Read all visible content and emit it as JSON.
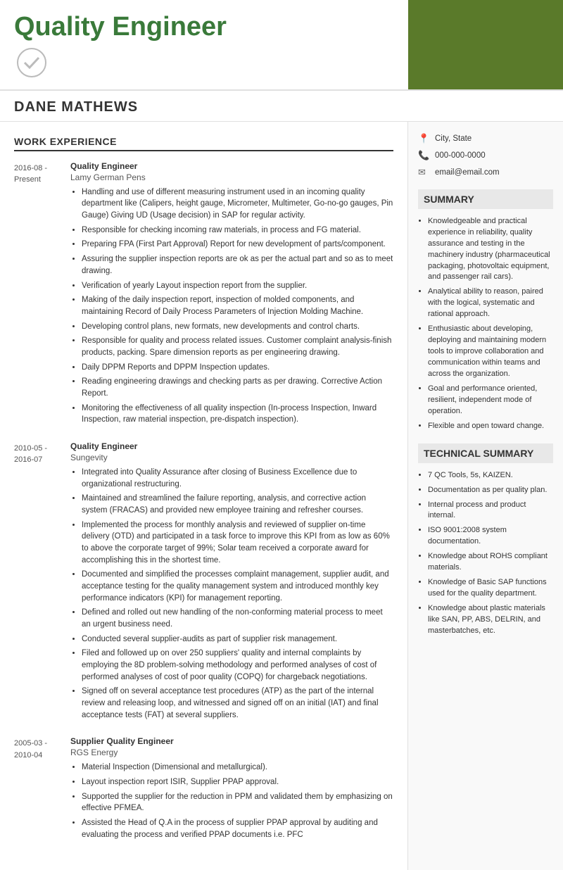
{
  "header": {
    "title": "Quality Engineer",
    "accent_color": "#5a7a2a"
  },
  "name": "DANE MATHEWS",
  "contact": {
    "location": "City, State",
    "phone": "000-000-0000",
    "email": "email@email.com"
  },
  "work_experience": {
    "section_title": "WORK EXPERIENCE",
    "jobs": [
      {
        "date_start": "2016-08 -",
        "date_end": "Present",
        "title": "Quality Engineer",
        "company": "Lamy German Pens",
        "bullets": [
          "Handling and use of different measuring instrument used in an incoming quality department like (Calipers, height gauge, Micrometer, Multimeter, Go-no-go gauges, Pin Gauge) Giving UD (Usage decision) in SAP for regular activity.",
          "Responsible for checking incoming raw materials, in process and FG material.",
          "Preparing FPA (First Part Approval) Report for new development of parts/component.",
          "Assuring the supplier inspection reports are ok as per the actual part and so as to meet drawing.",
          "Verification of yearly Layout inspection report from the supplier.",
          "Making of the daily inspection report, inspection of molded components, and maintaining Record of Daily Process Parameters of Injection Molding Machine.",
          "Developing control plans, new formats, new developments and control charts.",
          "Responsible for quality and process related issues. Customer complaint analysis-finish products, packing. Spare dimension reports as per engineering drawing.",
          "Daily DPPM Reports and DPPM Inspection updates.",
          "Reading engineering drawings and checking parts as per drawing. Corrective Action Report.",
          "Monitoring the effectiveness of all quality inspection (In-process Inspection, Inward Inspection, raw material inspection, pre-dispatch inspection)."
        ]
      },
      {
        "date_start": "2010-05 -",
        "date_end": "2016-07",
        "title": "Quality Engineer",
        "company": "Sungevity",
        "bullets": [
          "Integrated into Quality Assurance after closing of Business Excellence due to organizational restructuring.",
          "Maintained and streamlined the failure reporting, analysis, and corrective action system (FRACAS) and provided new employee training and refresher courses.",
          "Implemented the process for monthly analysis and reviewed of supplier on-time delivery (OTD) and participated in a task force to improve this KPI from as low as 60% to above the corporate target of 99%; Solar team received a corporate award for accomplishing this in the shortest time.",
          "Documented and simplified the processes complaint management, supplier audit, and acceptance testing for the quality management system and introduced monthly key performance indicators (KPI) for management reporting.",
          "Defined and rolled out new handling of the non-conforming material process to meet an urgent business need.",
          "Conducted several supplier-audits as part of supplier risk management.",
          "Filed and followed up on over 250 suppliers' quality and internal complaints by employing the 8D problem-solving methodology and performed analyses of cost of performed analyses of cost of poor quality (COPQ) for chargeback negotiations.",
          "Signed off on several acceptance test procedures (ATP) as the part of the internal review and releasing loop, and witnessed and signed off on an initial (IAT) and final acceptance tests (FAT) at several suppliers."
        ]
      },
      {
        "date_start": "2005-03 -",
        "date_end": "2010-04",
        "title": "Supplier Quality Engineer",
        "company": "RGS Energy",
        "bullets": [
          "Material Inspection (Dimensional and metallurgical).",
          "Layout inspection report ISIR, Supplier PPAP approval.",
          "Supported the supplier for the reduction in PPM and validated them by emphasizing on effective PFMEA.",
          "Assisted the Head of Q.A in the process of supplier PPAP approval by auditing and evaluating the process and verified PPAP documents i.e. PFC"
        ]
      }
    ]
  },
  "summary": {
    "section_title": "SUMMARY",
    "bullets": [
      "Knowledgeable and practical experience in reliability, quality assurance and testing in the machinery industry (pharmaceutical packaging, photovoltaic equipment, and passenger rail cars).",
      "Analytical ability to reason, paired with the logical, systematic and rational approach.",
      "Enthusiastic about developing, deploying and maintaining modern tools to improve collaboration and communication within teams and across the organization.",
      "Goal and performance oriented, resilient, independent mode of operation.",
      "Flexible and open toward change."
    ]
  },
  "technical_summary": {
    "section_title": "TECHNICAL SUMMARY",
    "bullets": [
      "7 QC Tools, 5s, KAIZEN.",
      "Documentation as per quality plan.",
      "Internal process and product internal.",
      "ISO 9001:2008 system documentation.",
      "Knowledge about ROHS compliant materials.",
      "Knowledge of Basic SAP functions used for the quality department.",
      "Knowledge about plastic materials like SAN, PP, ABS, DELRIN, and masterbatches, etc."
    ]
  }
}
